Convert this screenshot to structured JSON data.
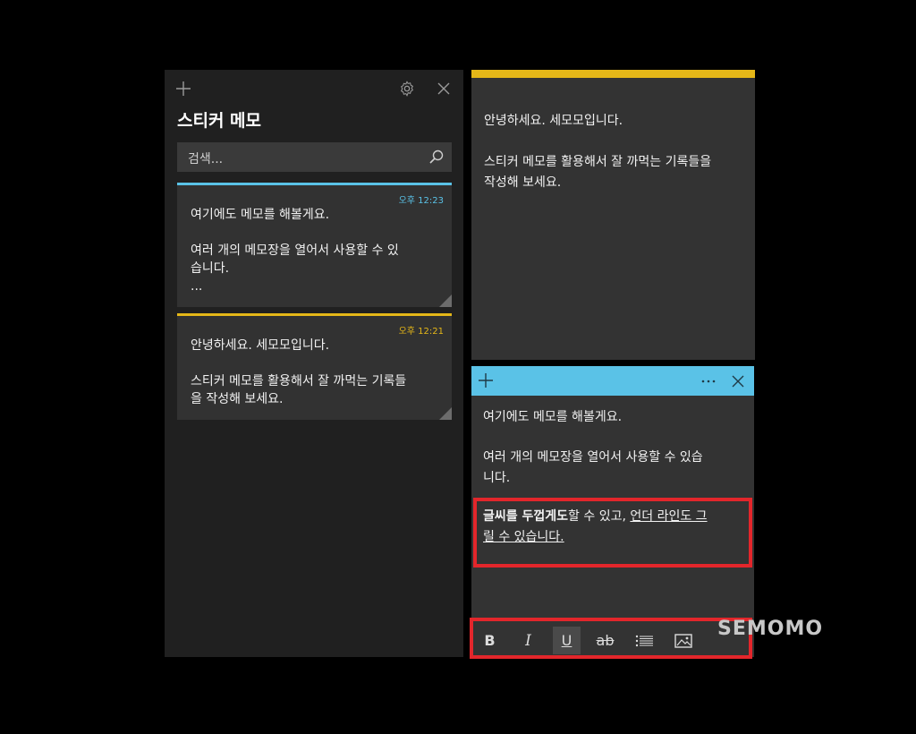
{
  "list_window": {
    "title": "스티커 메모",
    "search": {
      "placeholder": "검색..."
    },
    "notes": [
      {
        "time": "오후 12:23",
        "accent": "#5ac2e7",
        "lines": [
          "여기에도 메모를 해볼게요.",
          "",
          "여러 개의 메모장을 열어서 사용할 수 있",
          "습니다.",
          "..."
        ]
      },
      {
        "time": "오후 12:21",
        "accent": "#e5b718",
        "lines": [
          "안녕하세요. 세모모입니다.",
          "",
          "스티커 메모를 활용해서 잘 까먹는 기록들",
          "을 작성해 보세요."
        ]
      }
    ]
  },
  "yellow_note": {
    "color": "#e5b718",
    "lines": [
      "안녕하세요. 세모모입니다.",
      "",
      "스티커 메모를 활용해서 잘 까먹는 기록들을",
      "작성해 보세요."
    ]
  },
  "blue_note": {
    "color": "#5ac2e7",
    "line1": "여기에도 메모를 해볼게요.",
    "line2": "여러 개의 메모장을 열어서 사용할 수 있습",
    "line3": "니다.",
    "formatted": {
      "bold": "글씨를 두껍게도",
      "plain": "할 수 있고, ",
      "underline_1": "언더 라인도 그",
      "underline_2": "릴 수 있습니다."
    },
    "toolbar": {
      "bold": "B",
      "italic": "I",
      "underline": "U",
      "strike": "ab"
    }
  },
  "highlight_color": "#e3262b",
  "watermark": "SEMOMO"
}
